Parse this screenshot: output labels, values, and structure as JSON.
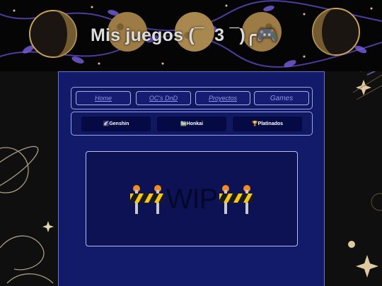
{
  "header": {
    "title": "Mis juegos (¯  3 ¯)╭🎮"
  },
  "nav": {
    "items": [
      {
        "label": "Home"
      },
      {
        "label": "OC's  DnD"
      },
      {
        "label": "Proyectos"
      },
      {
        "label": "Games"
      }
    ]
  },
  "games": {
    "items": [
      {
        "label": "🌠Genshin",
        "icon": "shooting-star-icon"
      },
      {
        "label": "🚞Honkai",
        "icon": "train-icon"
      },
      {
        "label": "🏆Platinados",
        "icon": "trophy-icon"
      }
    ]
  },
  "content": {
    "wip_text": "WIP",
    "icon": "construction-barrier-icon"
  },
  "colors": {
    "panel_bg": "#121b6a",
    "button_bg": "#050a45",
    "nav_text": "#8f97e6",
    "border": "#9aa3ef"
  }
}
